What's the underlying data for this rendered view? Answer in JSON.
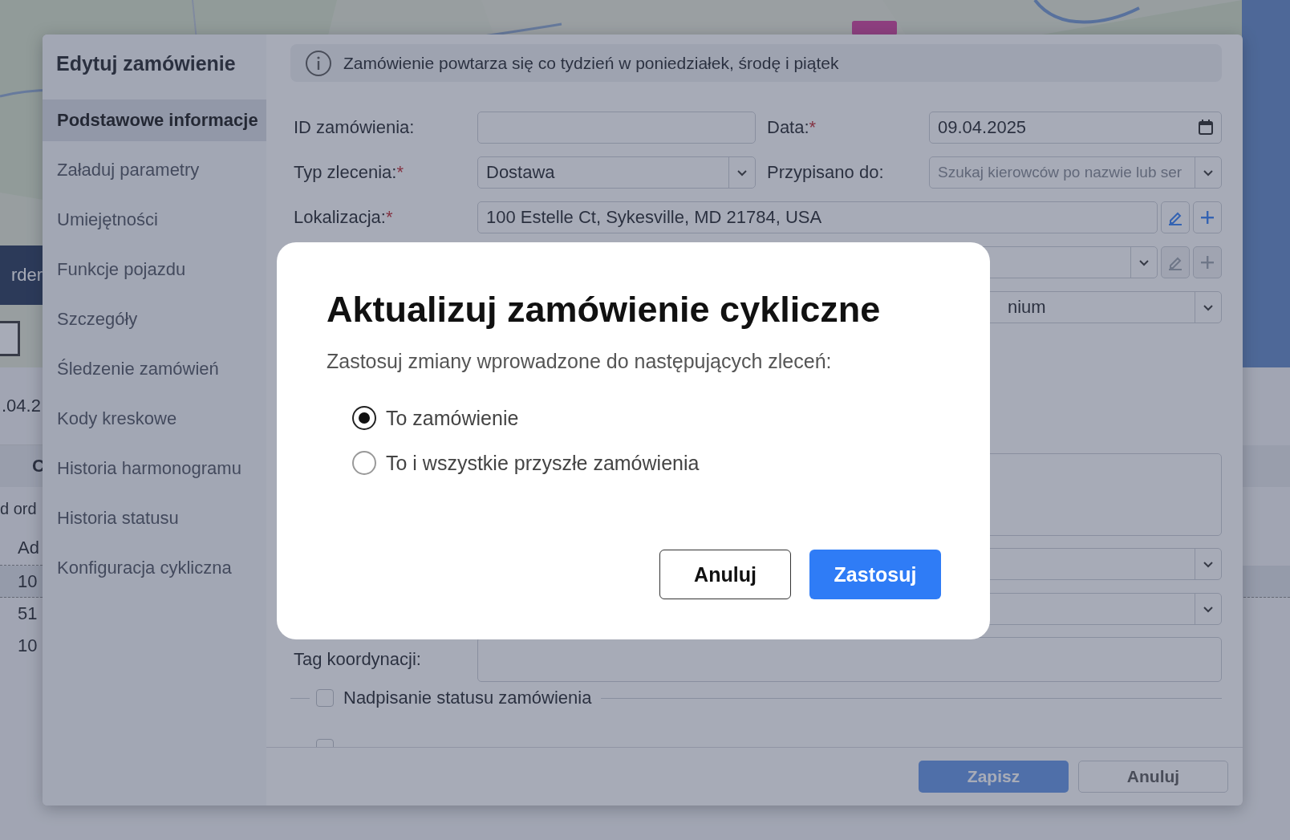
{
  "background": {
    "order_button": "rder",
    "date_fragment": ".04.2",
    "column_header": "C",
    "tab_fragment": "d ord",
    "address_header": "Ad",
    "rows": [
      {
        "text": "10",
        "selected": true
      },
      {
        "text": "51",
        "selected": false
      },
      {
        "text": "10",
        "selected": false
      }
    ]
  },
  "edit_dialog": {
    "title": "Edytuj zamówienie",
    "nav": [
      {
        "label": "Podstawowe informacje",
        "selected": true
      },
      {
        "label": "Załaduj parametry",
        "selected": false
      },
      {
        "label": "Umiejętności",
        "selected": false
      },
      {
        "label": "Funkcje pojazdu",
        "selected": false
      },
      {
        "label": "Szczegóły",
        "selected": false
      },
      {
        "label": "Śledzenie zamówień",
        "selected": false
      },
      {
        "label": "Kody kreskowe",
        "selected": false
      },
      {
        "label": "Historia harmonogramu",
        "selected": false
      },
      {
        "label": "Historia statusu",
        "selected": false
      },
      {
        "label": "Konfiguracja cykliczna",
        "selected": false
      }
    ],
    "banner": "Zamówienie powtarza się co tydzień w poniedziałek, środę i piątek",
    "rows": [
      {
        "kind": "pair",
        "fields": [
          {
            "label": "ID zamówienia:",
            "kind": "input"
          },
          {
            "label": "Data:",
            "required_mark": "*",
            "kind": "date",
            "value": "09.04.2025"
          }
        ]
      },
      {
        "kind": "pair",
        "fields": [
          {
            "label": "Typ zlecenia:",
            "required_mark": "*",
            "kind": "select",
            "value": "Dostawa"
          },
          {
            "label": "Przypisano do:",
            "kind": "select",
            "placeholder": "Szukaj kierowców po nazwie lub ser"
          }
        ]
      },
      {
        "kind": "wide",
        "fields": [
          {
            "label": "Lokalizacja:",
            "required_mark": "*",
            "kind": "input",
            "value": "100 Estelle Ct, Sykesville, MD 21784, USA",
            "actions": [
              {
                "kind": "edit",
                "disabled": false
              },
              {
                "kind": "add",
                "disabled": false
              }
            ]
          }
        ]
      },
      {
        "kind": "wide",
        "fields": [
          {
            "kind": "select",
            "actions": [
              {
                "kind": "edit",
                "disabled": true
              },
              {
                "kind": "add",
                "disabled": true
              }
            ]
          }
        ]
      },
      {
        "kind": "wide",
        "fields": [
          {
            "kind": "select-tail",
            "value": "nium"
          }
        ]
      },
      {
        "kind": "area",
        "fields": [
          {
            "kind": "textarea"
          }
        ]
      },
      {
        "kind": "wide",
        "fields": [
          {
            "kind": "select"
          }
        ]
      },
      {
        "kind": "wide",
        "fields": [
          {
            "kind": "select"
          }
        ]
      },
      {
        "kind": "wide",
        "fields": [
          {
            "label": "Tag koordynacji:",
            "kind": "input"
          }
        ]
      },
      {
        "kind": "check",
        "fields": [
          {
            "label": "Nadpisanie statusu zamówienia",
            "checked": false
          }
        ]
      },
      {
        "kind": "check",
        "fields": [
          {
            "checked": false
          }
        ]
      }
    ],
    "footer": [
      {
        "label": "Zapisz",
        "kind": "primary",
        "disabled": true
      },
      {
        "label": "Anuluj",
        "kind": "secondary"
      }
    ]
  },
  "modal": {
    "title": "Aktualizuj zamówienie cykliczne",
    "subtitle": "Zastosuj zmiany wprowadzone do następujących zleceń:",
    "options": [
      {
        "label": "To zamówienie",
        "selected": true
      },
      {
        "label": "To i wszystkie przyszłe zamówienia",
        "selected": false
      }
    ],
    "buttons": [
      {
        "label": "Anuluj",
        "kind": "secondary"
      },
      {
        "label": "Zastosuj",
        "kind": "primary"
      }
    ]
  }
}
